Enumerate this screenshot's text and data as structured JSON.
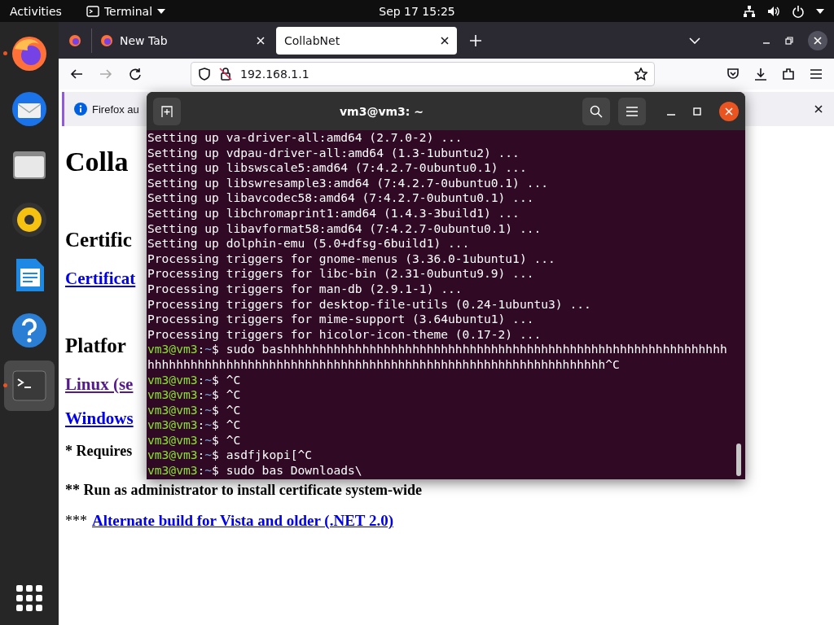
{
  "top_bar": {
    "activities": "Activities",
    "app_menu": "Terminal",
    "clock": "Sep 17  15:25"
  },
  "dock": {
    "items": [
      {
        "kind": "firefox",
        "running": true,
        "selected": false
      },
      {
        "kind": "mail",
        "running": false,
        "selected": false
      },
      {
        "kind": "files",
        "running": false,
        "selected": false
      },
      {
        "kind": "music",
        "running": false,
        "selected": false
      },
      {
        "kind": "writer",
        "running": false,
        "selected": false
      },
      {
        "kind": "help",
        "running": false,
        "selected": false
      },
      {
        "kind": "terminal",
        "running": true,
        "selected": true
      }
    ]
  },
  "browser": {
    "tabs": [
      {
        "label": "New Tab",
        "selected": false
      },
      {
        "label": "CollabNet",
        "selected": true
      }
    ],
    "address": "192.168.1.1",
    "notification": "Firefox au",
    "page": [
      {
        "kind": "h1",
        "text": "Colla"
      },
      {
        "kind": "h2",
        "text": "Certific"
      },
      {
        "kind": "link",
        "text": "Certificat",
        "visited": false
      },
      {
        "kind": "h2",
        "text": "Platfor"
      },
      {
        "kind": "link",
        "text": "Linux (se",
        "visited": true
      },
      {
        "kind": "link",
        "text": "Windows",
        "visited": false
      },
      {
        "kind": "note",
        "text": "* Requires"
      },
      {
        "kind": "note",
        "text": "** Run as administrator to install certificate system-wide"
      },
      {
        "kind": "note_link",
        "prefix": "***",
        "link": "Alternate build for Vista and older (.NET 2.0)"
      }
    ]
  },
  "terminal": {
    "title": "vm3@vm3: ~",
    "prompt_separator": ":",
    "prompt_sign": "$",
    "lines": [
      {
        "kind": "output",
        "text": "Setting up va-driver-all:amd64 (2.7.0-2) ..."
      },
      {
        "kind": "output",
        "text": "Setting up vdpau-driver-all:amd64 (1.3-1ubuntu2) ..."
      },
      {
        "kind": "output",
        "text": "Setting up libswscale5:amd64 (7:4.2.7-0ubuntu0.1) ..."
      },
      {
        "kind": "output",
        "text": "Setting up libswresample3:amd64 (7:4.2.7-0ubuntu0.1) ..."
      },
      {
        "kind": "output",
        "text": "Setting up libavcodec58:amd64 (7:4.2.7-0ubuntu0.1) ..."
      },
      {
        "kind": "output",
        "text": "Setting up libchromaprint1:amd64 (1.4.3-3build1) ..."
      },
      {
        "kind": "output",
        "text": "Setting up libavformat58:amd64 (7:4.2.7-0ubuntu0.1) ..."
      },
      {
        "kind": "output",
        "text": "Setting up dolphin-emu (5.0+dfsg-6build1) ..."
      },
      {
        "kind": "output",
        "text": "Processing triggers for gnome-menus (3.36.0-1ubuntu1) ..."
      },
      {
        "kind": "output",
        "text": "Processing triggers for libc-bin (2.31-0ubuntu9.9) ..."
      },
      {
        "kind": "output",
        "text": "Processing triggers for man-db (2.9.1-1) ..."
      },
      {
        "kind": "output",
        "text": "Processing triggers for desktop-file-utils (0.24-1ubuntu3) ..."
      },
      {
        "kind": "output",
        "text": "Processing triggers for mime-support (3.64ubuntu1) ..."
      },
      {
        "kind": "output",
        "text": "Processing triggers for hicolor-icon-theme (0.17-2) ..."
      },
      {
        "kind": "prompt",
        "user": "vm3@vm3",
        "path": "~",
        "command": "sudo bashhhhhhhhhhhhhhhhhhhhhhhhhhhhhhhhhhhhhhhhhhhhhhhhhhhhhhhhhhhhhh"
      },
      {
        "kind": "output",
        "text": "hhhhhhhhhhhhhhhhhhhhhhhhhhhhhhhhhhhhhhhhhhhhhhhhhhhhhhhhhhhhhhhh^C"
      },
      {
        "kind": "prompt",
        "user": "vm3@vm3",
        "path": "~",
        "command": "^C"
      },
      {
        "kind": "prompt",
        "user": "vm3@vm3",
        "path": "~",
        "command": "^C"
      },
      {
        "kind": "prompt",
        "user": "vm3@vm3",
        "path": "~",
        "command": "^C"
      },
      {
        "kind": "prompt",
        "user": "vm3@vm3",
        "path": "~",
        "command": "^C"
      },
      {
        "kind": "prompt",
        "user": "vm3@vm3",
        "path": "~",
        "command": "^C"
      },
      {
        "kind": "prompt",
        "user": "vm3@vm3",
        "path": "~",
        "command": "asdfjkopi[^C"
      },
      {
        "kind": "prompt",
        "user": "vm3@vm3",
        "path": "~",
        "command": "sudo bas Downloads\\"
      }
    ]
  }
}
